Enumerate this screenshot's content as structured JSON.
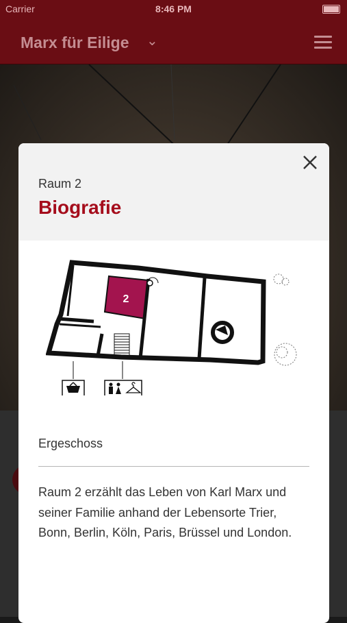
{
  "status": {
    "carrier": "Carrier",
    "time": "8:46 PM"
  },
  "navbar": {
    "title": "Marx für Eilige",
    "chevron": "⌄"
  },
  "modal": {
    "room_label": "Raum 2",
    "room_title": "Biografie",
    "plan_room_number": "2",
    "floor": "Ergeschoss",
    "description": "Raum 2 erzählt das Leben von Karl Marx und seiner Familie anhand der Lebensorte Trier, Bonn, Berlin, Köln, Paris, Brüssel und London.",
    "highlight_color": "#a3144e"
  },
  "icons": [
    "close-icon",
    "menu-icon",
    "chevron-down-icon",
    "shop-basket-icon",
    "toilet-icon",
    "wardrobe-icon"
  ]
}
